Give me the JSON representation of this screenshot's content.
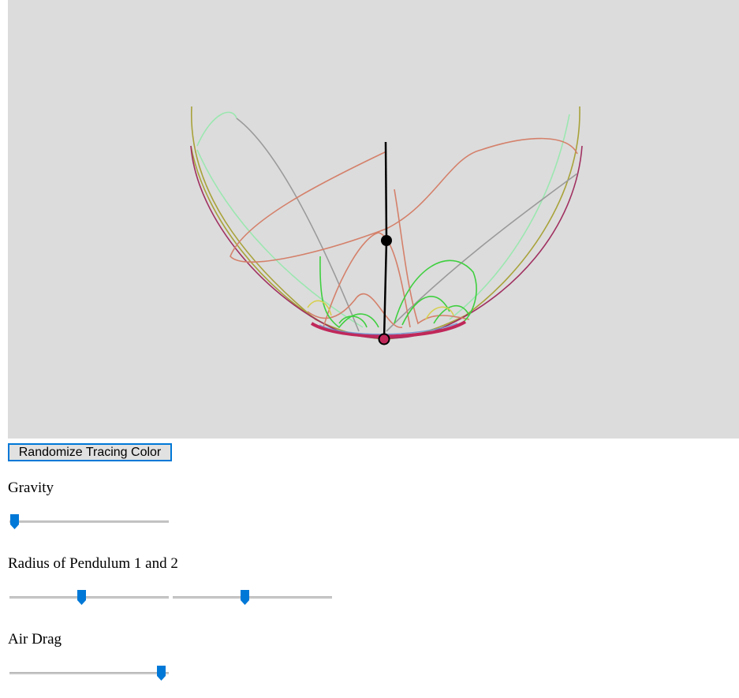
{
  "app": {
    "randomize_button": "Randomize Tracing Color"
  },
  "controls": {
    "gravity_label": "Gravity",
    "radius_label": "Radius of Pendulum 1 and 2",
    "drag_label": "Air Drag"
  },
  "sliders": {
    "gravity": 0.03,
    "radius1": 0.45,
    "radius2": 0.45,
    "air_drag": 0.95
  },
  "colors": {
    "canvas_background": "#dcdcdc",
    "accent": "#0078d7",
    "rod": "#000000",
    "bob2_fill": "#c0285a",
    "trace_colors": [
      "#9be7b0",
      "#9a9a9a",
      "#d4806a",
      "#a8a23a",
      "#a03060",
      "#3fcf3f",
      "#d6cf50"
    ]
  }
}
